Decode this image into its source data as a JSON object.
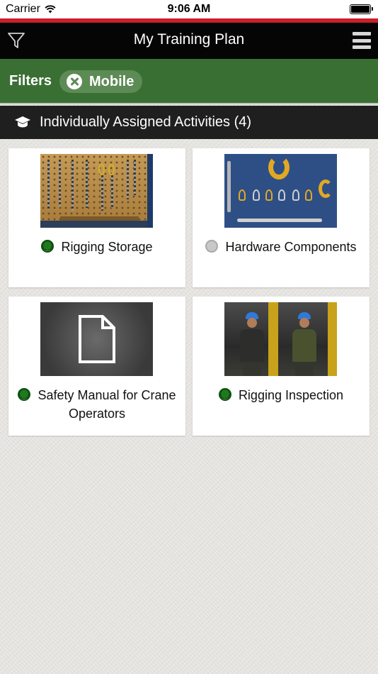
{
  "status_bar": {
    "carrier": "Carrier",
    "time": "9:06 AM"
  },
  "nav": {
    "title": "My Training Plan",
    "left_icon": "filter-funnel-icon",
    "right_icon": "hamburger-menu-icon"
  },
  "filters": {
    "label": "Filters",
    "active": [
      {
        "label": "Mobile",
        "icon": "clear-x-icon"
      }
    ]
  },
  "section": {
    "title": "Individually Assigned Activities (4)",
    "icon": "graduation-cap-icon"
  },
  "activities": [
    {
      "title": "Rigging Storage",
      "status": "complete",
      "thumbnail": "rigging-storage-photo"
    },
    {
      "title": "Hardware Components",
      "status": "not-started",
      "thumbnail": "hardware-components-photo"
    },
    {
      "title": "Safety Manual for Crane Operators",
      "status": "complete",
      "thumbnail": "document-icon"
    },
    {
      "title": "Rigging Inspection",
      "status": "complete",
      "thumbnail": "rigging-inspection-photo"
    }
  ],
  "colors": {
    "brand_red": "#c9202b",
    "filter_green": "#3a6f33",
    "complete_green": "#1f7a1f",
    "not_started_gray": "#c8c8c8"
  }
}
